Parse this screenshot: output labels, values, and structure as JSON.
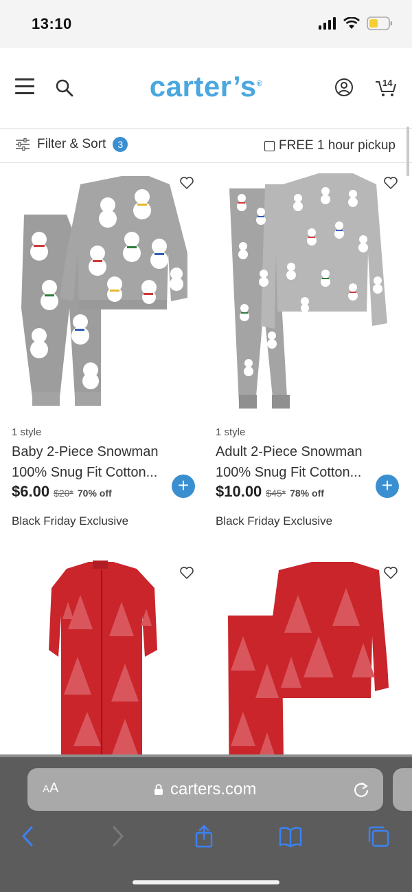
{
  "status_bar": {
    "time": "13:10"
  },
  "header": {
    "logo": "carter’s",
    "logo_mark": "®",
    "cart_count": "14"
  },
  "filter_bar": {
    "filter_label": "Filter & Sort",
    "filter_count": "3",
    "pickup_label": "FREE 1 hour pickup"
  },
  "products": [
    {
      "styles": "1 style",
      "title_line1": "Baby 2-Piece Snowman",
      "title_line2": "100% Snug Fit Cotton...",
      "price": "$6.00",
      "was_price": "$20*",
      "discount": "70% off",
      "badge": "Black Friday Exclusive"
    },
    {
      "styles": "1 style",
      "title_line1": "Adult 2-Piece Snowman",
      "title_line2": "100% Snug Fit Cotton...",
      "price": "$10.00",
      "was_price": "$45*",
      "discount": "78% off",
      "badge": "Black Friday Exclusive"
    }
  ],
  "browser": {
    "aa_large": "A",
    "aa_small": "A",
    "url": "carters.com"
  },
  "colors": {
    "brand": "#4aa7df",
    "accent": "#3a8fd0",
    "pajama_gray": "#9a9a9a",
    "pajama_red": "#c9252b"
  }
}
